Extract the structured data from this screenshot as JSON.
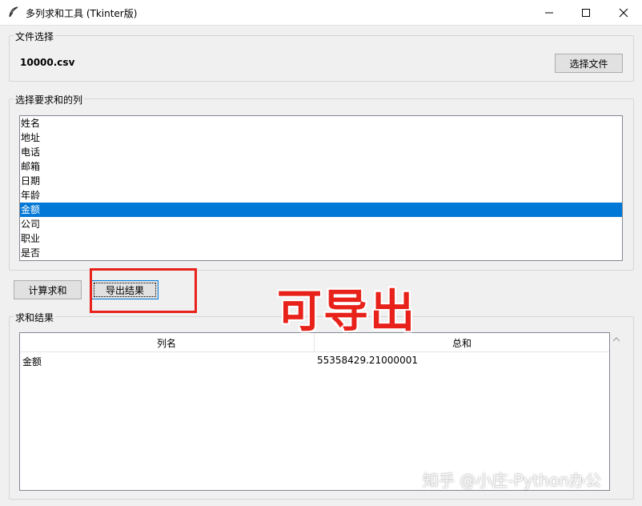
{
  "window": {
    "title": "多列求和工具 (Tkinter版)",
    "icon": "feather-icon"
  },
  "file_group": {
    "label": "文件选择",
    "file_name": "10000.csv",
    "choose_button": "选择文件"
  },
  "columns_group": {
    "label": "选择要求和的列",
    "items": [
      "姓名",
      "地址",
      "电话",
      "邮箱",
      "日期",
      "年龄",
      "金额",
      "公司",
      "职业",
      "是否"
    ],
    "selected": "金额"
  },
  "actions": {
    "compute_button": "计算求和",
    "export_button": "导出结果"
  },
  "results_group": {
    "label": "求和结果",
    "headers": [
      "列名",
      "总和"
    ],
    "rows": [
      {
        "name": "金额",
        "sum": "55358429.21000001"
      }
    ]
  },
  "annotation": {
    "text": "可导出",
    "color": "#e8221b"
  },
  "watermark": {
    "text": "知乎 @小庄-Python办公"
  },
  "colors": {
    "selection": "#0078d7",
    "window_bg": "#f0f0f0"
  }
}
